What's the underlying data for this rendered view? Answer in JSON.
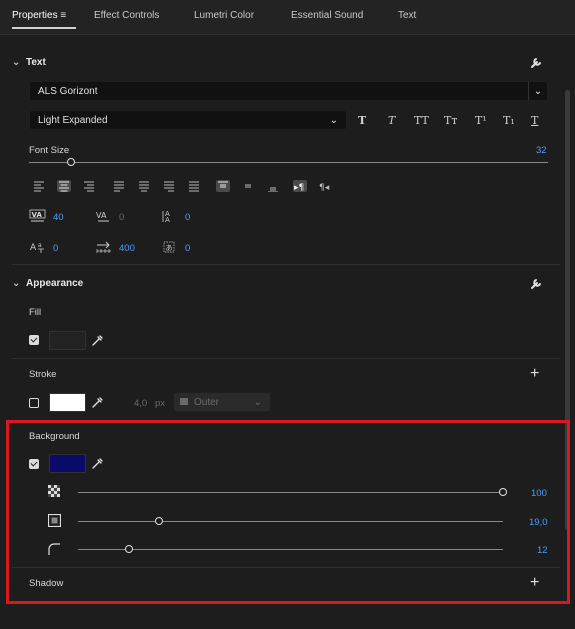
{
  "tabs": [
    {
      "label": "Properties"
    },
    {
      "label": "Effect Controls"
    },
    {
      "label": "Lumetri Color"
    },
    {
      "label": "Essential Sound"
    },
    {
      "label": "Text"
    }
  ],
  "colors": {
    "accent": "#4a9fff",
    "highlight": "#d7191f",
    "background_swatch": "#0a0a6a",
    "stroke_swatch": "#ffffff"
  },
  "text_section": {
    "title": "Text",
    "font_family": "ALS Gorizont",
    "font_style": "Light Expanded",
    "style_buttons": [
      "T",
      "T",
      "TT",
      "Tт",
      "T¹",
      "T₁",
      "T"
    ],
    "font_size_label": "Font Size",
    "font_size_value": "32",
    "font_size_level": 0.08,
    "kerning_value": "40",
    "tracking_value": "0",
    "leading_value": "0",
    "baseline_value": "0",
    "tab_width_value": "400",
    "tsume_value": "0"
  },
  "appearance": {
    "title": "Appearance",
    "fill_label": "Fill",
    "stroke_label": "Stroke",
    "stroke_width": "4,0",
    "stroke_unit": "px",
    "stroke_type": "Outer",
    "background_label": "Background",
    "bg_opacity_value": "100",
    "bg_opacity_level": 1.0,
    "bg_size_value": "19,0",
    "bg_size_level": 0.19,
    "bg_corner_value": "12",
    "bg_corner_level": 0.12,
    "shadow_label": "Shadow"
  }
}
